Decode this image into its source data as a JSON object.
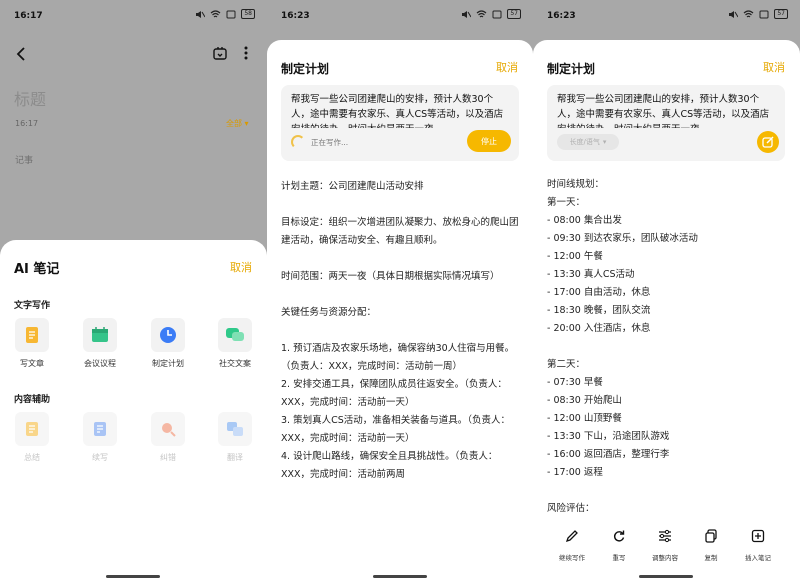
{
  "panel1": {
    "status": {
      "time": "16:17",
      "battery": "58"
    },
    "note": {
      "title_placeholder": "标题",
      "time": "16:17",
      "folder": "全部",
      "body_placeholder": "记事"
    },
    "sheet": {
      "title": "AI 笔记",
      "cancel": "取消",
      "section_writing": "文字写作",
      "writing_tools": [
        {
          "label": "写文章",
          "icon": "document-pen-icon",
          "color": "#f7b733"
        },
        {
          "label": "会议议程",
          "icon": "calendar-icon",
          "color": "#36c48a"
        },
        {
          "label": "制定计划",
          "icon": "clock-icon",
          "color": "#3b7cf6"
        },
        {
          "label": "社交文案",
          "icon": "chat-bubbles-icon",
          "color": "#2fc98a"
        }
      ],
      "section_assist": "内容辅助",
      "assist_tools": [
        {
          "label": "总结",
          "icon": "summary-icon",
          "color": "#f9d68a"
        },
        {
          "label": "续写",
          "icon": "continue-write-icon",
          "color": "#a9c4f5"
        },
        {
          "label": "纠错",
          "icon": "proofread-icon",
          "color": "#f5b7a3"
        },
        {
          "label": "翻译",
          "icon": "translate-icon",
          "color": "#a9c9f5"
        }
      ]
    }
  },
  "panel2": {
    "status": {
      "time": "16:23",
      "battery": "57"
    },
    "title": "制定计划",
    "cancel": "取消",
    "prompt": "帮我写一些公司团建爬山的安排，预计人数30个人，途中需要有农家乐、真人CS等活动，以及酒店安排的待办，时间大约是两天一夜",
    "writing_status": "正在写作...",
    "stop_label": "停止",
    "content": [
      "计划主题：公司团建爬山活动安排",
      "",
      "目标设定：组织一次增进团队凝聚力、放松身心的爬山团建活动，确保活动安全、有趣且顺利。",
      "",
      "时间范围：两天一夜（具体日期根据实际情况填写）",
      "",
      "关键任务与资源分配：",
      "",
      "1. 预订酒店及农家乐场地，确保容纳30人住宿与用餐。（负责人：XXX，完成时间：活动前一周）",
      "2. 安排交通工具，保障团队成员往返安全。（负责人：XXX，完成时间：活动前一天）",
      "3. 策划真人CS活动，准备相关装备与道具。（负责人：XXX，完成时间：活动前一天）",
      "4. 设计爬山路线，确保安全且具挑战性。（负责人：XXX，完成时间：活动前两周"
    ]
  },
  "panel3": {
    "status": {
      "time": "16:23",
      "battery": "57"
    },
    "title": "制定计划",
    "cancel": "取消",
    "prompt": "帮我写一些公司团建爬山的安排，预计人数30个人，途中需要有农家乐、真人CS等活动，以及酒店安排的待办，时间大约是两天一夜",
    "length_chip": "长度/语气",
    "content": [
      "时间线规划：",
      "第一天：",
      "- 08:00 集合出发",
      "- 09:30 到达农家乐，团队破冰活动",
      "- 12:00 午餐",
      "- 13:30 真人CS活动",
      "- 17:00 自由活动，休息",
      "- 18:30 晚餐，团队交流",
      "- 20:00 入住酒店，休息",
      "",
      "第二天：",
      "- 07:30 早餐",
      "- 08:30 开始爬山",
      "- 12:00 山顶野餐",
      "- 13:30 下山，沿途团队游戏",
      "- 16:00 返回酒店，整理行李",
      "- 17:00 返程",
      "",
      "风险评估："
    ],
    "actions": [
      {
        "label": "继续写作",
        "icon": "pencil-icon"
      },
      {
        "label": "重写",
        "icon": "refresh-icon"
      },
      {
        "label": "调整内容",
        "icon": "sliders-icon"
      },
      {
        "label": "复制",
        "icon": "copy-icon"
      },
      {
        "label": "插入笔记",
        "icon": "insert-plus-icon"
      }
    ]
  }
}
